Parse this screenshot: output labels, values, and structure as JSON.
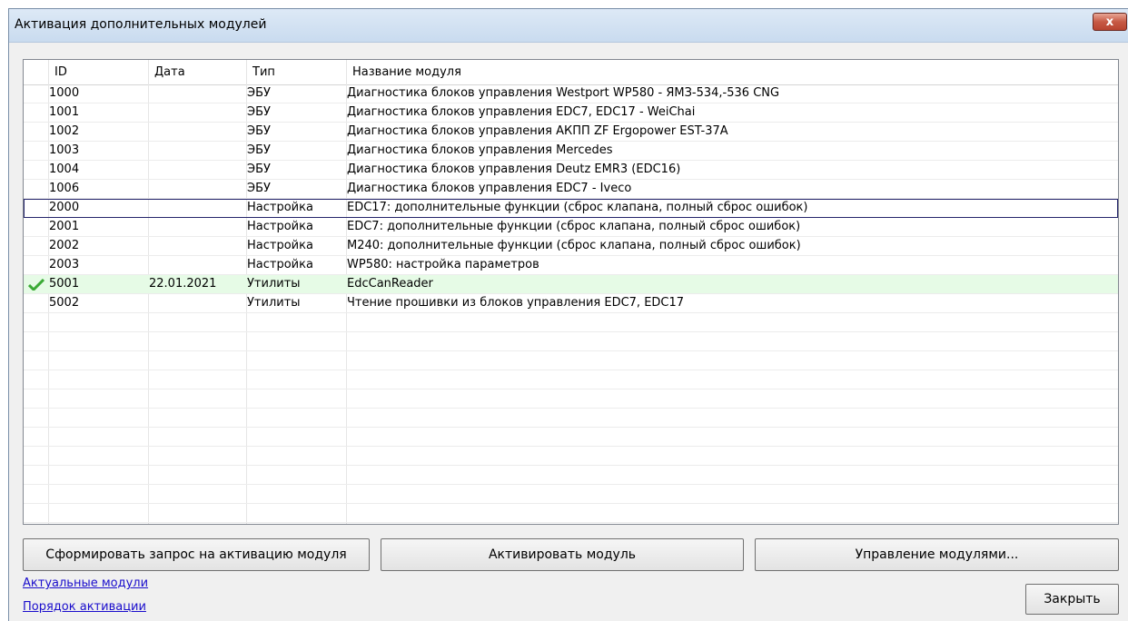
{
  "window": {
    "title": "Активация дополнительных модулей",
    "close_label": "x"
  },
  "table": {
    "columns": [
      "ID",
      "Дата",
      "Тип",
      "Название модуля"
    ],
    "rows": [
      {
        "id": "1000",
        "date": "",
        "type": "ЭБУ",
        "name": "Диагностика блоков управления Westport WP580 - ЯМЗ-534,-536 CNG"
      },
      {
        "id": "1001",
        "date": "",
        "type": "ЭБУ",
        "name": "Диагностика блоков управления EDC7, EDC17 - WeiChai"
      },
      {
        "id": "1002",
        "date": "",
        "type": "ЭБУ",
        "name": "Диагностика блоков управления АКПП ZF Ergopower EST-37A"
      },
      {
        "id": "1003",
        "date": "",
        "type": "ЭБУ",
        "name": "Диагностика блоков управления Mercedes"
      },
      {
        "id": "1004",
        "date": "",
        "type": "ЭБУ",
        "name": "Диагностика блоков управления Deutz EMR3 (EDC16)"
      },
      {
        "id": "1006",
        "date": "",
        "type": "ЭБУ",
        "name": "Диагностика блоков управления EDC7 - Iveco"
      },
      {
        "id": "2000",
        "date": "",
        "type": "Настройка",
        "name": "EDC17: дополнительные функции (сброс клапана, полный сброс ошибок)"
      },
      {
        "id": "2001",
        "date": "",
        "type": "Настройка",
        "name": "EDC7: дополнительные функции (сброс клапана, полный сброс ошибок)"
      },
      {
        "id": "2002",
        "date": "",
        "type": "Настройка",
        "name": "M240: дополнительные функции (сброс клапана, полный сброс ошибок)"
      },
      {
        "id": "2003",
        "date": "",
        "type": "Настройка",
        "name": "WP580: настройка параметров"
      },
      {
        "id": "5001",
        "date": "22.01.2021",
        "type": "Утилиты",
        "name": "EdcCanReader"
      },
      {
        "id": "5002",
        "date": "",
        "type": "Утилиты",
        "name": "Чтение прошивки из блоков управления EDC7, EDC17"
      }
    ],
    "selected_row": "2000",
    "activated_row": "5001",
    "activated_icon": "checkmark-icon"
  },
  "buttons": {
    "request": "Сформировать запрос на активацию модуля",
    "activate": "Активировать модуль",
    "manage": "Управление модулями...",
    "close": "Закрыть"
  },
  "links": {
    "current_modules": "Актуальные модули",
    "activation_order": "Порядок активации"
  },
  "colors": {
    "link": "#1a0dcc",
    "activated_row_bg": "#e6fbe6",
    "check": "#3aaa35"
  }
}
